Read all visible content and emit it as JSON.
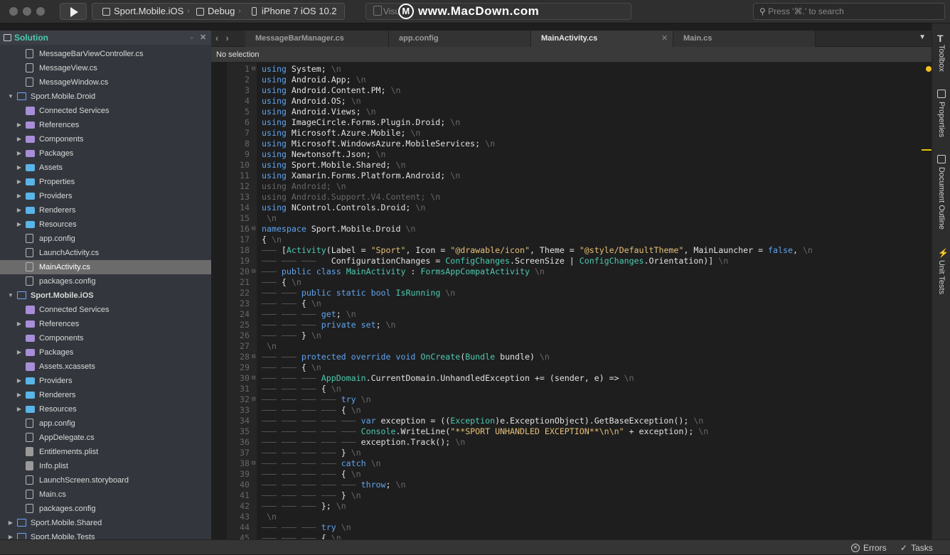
{
  "toolbar": {
    "scheme": "Sport.Mobile.iOS",
    "config": "Debug",
    "device": "iPhone 7 iOS 10.2",
    "status": "Visu",
    "watermark": "www.MacDown.com",
    "search_placeholder": "Press '⌘.' to search"
  },
  "solution": {
    "title": "Solution",
    "items": [
      {
        "label": "MessageBarViewController.cs",
        "icon": "code-file-icon"
      },
      {
        "label": "MessageView.cs",
        "icon": "code-file-icon"
      },
      {
        "label": "MessageWindow.cs",
        "icon": "code-file-icon"
      },
      {
        "label": "Sport.Mobile.Droid",
        "icon": "project-icon"
      },
      {
        "label": "Connected Services",
        "icon": "connected-services-icon"
      },
      {
        "label": "References",
        "icon": "references-folder-icon"
      },
      {
        "label": "Components",
        "icon": "components-folder-icon"
      },
      {
        "label": "Packages",
        "icon": "packages-folder-icon"
      },
      {
        "label": "Assets",
        "icon": "folder-icon"
      },
      {
        "label": "Properties",
        "icon": "folder-icon"
      },
      {
        "label": "Providers",
        "icon": "folder-icon"
      },
      {
        "label": "Renderers",
        "icon": "folder-icon"
      },
      {
        "label": "Resources",
        "icon": "folder-icon"
      },
      {
        "label": "app.config",
        "icon": "config-file-icon"
      },
      {
        "label": "LaunchActivity.cs",
        "icon": "code-file-icon"
      },
      {
        "label": "MainActivity.cs",
        "icon": "code-file-icon"
      },
      {
        "label": "packages.config",
        "icon": "config-file-icon"
      },
      {
        "label": "Sport.Mobile.iOS",
        "icon": "project-icon"
      },
      {
        "label": "Connected Services",
        "icon": "connected-services-icon"
      },
      {
        "label": "References",
        "icon": "references-folder-icon"
      },
      {
        "label": "Components",
        "icon": "components-folder-icon"
      },
      {
        "label": "Packages",
        "icon": "packages-folder-icon"
      },
      {
        "label": "Assets.xcassets",
        "icon": "asset-catalog-icon"
      },
      {
        "label": "Providers",
        "icon": "folder-icon"
      },
      {
        "label": "Renderers",
        "icon": "folder-icon"
      },
      {
        "label": "Resources",
        "icon": "folder-icon"
      },
      {
        "label": "app.config",
        "icon": "config-file-icon"
      },
      {
        "label": "AppDelegate.cs",
        "icon": "code-file-icon"
      },
      {
        "label": "Entitlements.plist",
        "icon": "plist-file-icon"
      },
      {
        "label": "Info.plist",
        "icon": "plist-file-icon"
      },
      {
        "label": "LaunchScreen.storyboard",
        "icon": "storyboard-file-icon"
      },
      {
        "label": "Main.cs",
        "icon": "code-file-icon"
      },
      {
        "label": "packages.config",
        "icon": "config-file-icon"
      },
      {
        "label": "Sport.Mobile.Shared",
        "icon": "project-icon"
      },
      {
        "label": "Sport.Mobile.Tests",
        "icon": "project-icon"
      }
    ]
  },
  "tabs": [
    {
      "label": "MessageBarManager.cs"
    },
    {
      "label": "app.config"
    },
    {
      "label": "MainActivity.cs",
      "active": true
    },
    {
      "label": "Main.cs"
    }
  ],
  "editor": {
    "selection": "No selection",
    "lines": [
      "using System;",
      "using Android.App;",
      "using Android.Content.PM;",
      "using Android.OS;",
      "using Android.Views;",
      "using ImageCircle.Forms.Plugin.Droid;",
      "using Microsoft.Azure.Mobile;",
      "using Microsoft.WindowsAzure.MobileServices;",
      "using Newtonsoft.Json;",
      "using Sport.Mobile.Shared;",
      "using Xamarin.Forms.Platform.Android;",
      "using Android;",
      "using Android.Support.V4.Content;",
      "using NControl.Controls.Droid;",
      "",
      "namespace Sport.Mobile.Droid",
      "{",
      "    [Activity(Label = \"Sport\", Icon = \"@drawable/icon\", Theme = \"@style/DefaultTheme\", MainLauncher = false,",
      "              ConfigurationChanges = ConfigChanges.ScreenSize | ConfigChanges.Orientation)]",
      "    public class MainActivity : FormsAppCompatActivity",
      "    {",
      "        public static bool IsRunning",
      "        {",
      "            get;",
      "            private set;",
      "        }",
      "",
      "        protected override void OnCreate(Bundle bundle)",
      "        {",
      "            AppDomain.CurrentDomain.UnhandledException += (sender, e) =>",
      "            {",
      "                try",
      "                {",
      "                    var exception = ((Exception)e.ExceptionObject).GetBaseException();",
      "                    Console.WriteLine(\"**SPORT UNHANDLED EXCEPTION**\\n\\n\" + exception);",
      "                    exception.Track();",
      "                }",
      "                catch",
      "                {",
      "                    throw;",
      "                }",
      "            };",
      "",
      "            try",
      "            {"
    ]
  },
  "right_panel": {
    "toolbox": "Toolbox",
    "properties": "Properties",
    "outline": "Document Outline",
    "tests": "Unit Tests"
  },
  "status": {
    "errors": "Errors",
    "tasks": "Tasks"
  }
}
